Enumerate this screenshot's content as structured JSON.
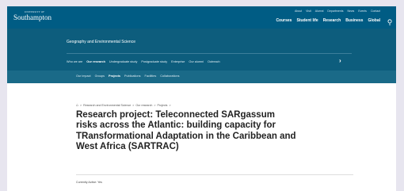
{
  "brand": {
    "small": "UNIVERSITY OF",
    "name": "Southampton"
  },
  "utility_links": [
    "About",
    "Visit",
    "Alumni",
    "Departments",
    "News",
    "Events",
    "Contact"
  ],
  "main_nav": [
    "Courses",
    "Student life",
    "Research",
    "Business",
    "Global"
  ],
  "department": {
    "title": "Geography and Environmental Science",
    "nav": [
      "Who we are",
      "Our research",
      "Undergraduate study",
      "Postgraduate study",
      "Enterprise",
      "Our alumni",
      "Outreach"
    ],
    "nav_active": "Our research"
  },
  "sub_nav": {
    "items": [
      "Our impact",
      "Groups",
      "Projects",
      "Publications",
      "Facilities",
      "Collaborations"
    ],
    "active": "Projects"
  },
  "breadcrumb": {
    "items": [
      "Research and Environmental Science",
      "Our research",
      "Projects"
    ],
    "separator": ">"
  },
  "page": {
    "title": "Research project: Teleconnected SARgassum risks across the Atlantic: building capacity for TRansformational Adaptation in the Caribbean and West Africa (SARTRAC)",
    "status": "Currently Active: Yes"
  },
  "colors": {
    "primary": "#005c84",
    "band": "#0d5d7d",
    "sub_band": "#1a6a88"
  },
  "icons": {
    "search": "search-icon",
    "home": "home-icon",
    "chevron": "chevron-right-icon"
  }
}
